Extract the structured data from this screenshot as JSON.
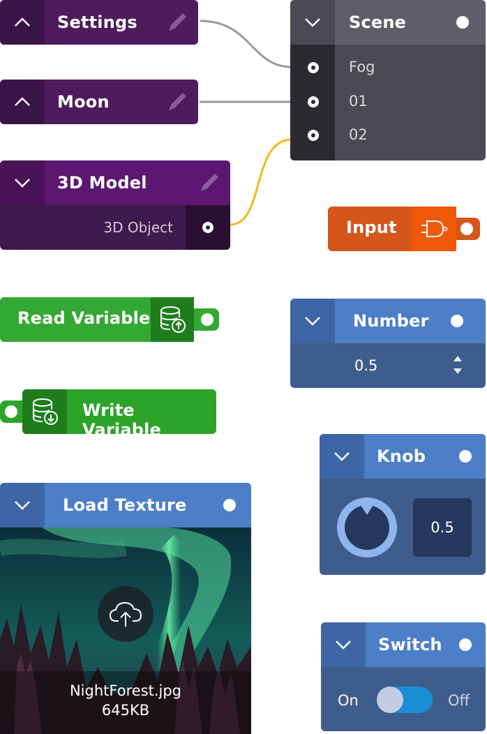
{
  "settings_node": {
    "title": "Settings",
    "collapse_icon": "chevron-up-icon",
    "edit_icon": "pencil-icon"
  },
  "moon_node": {
    "title": "Moon",
    "collapse_icon": "chevron-up-icon",
    "edit_icon": "pencil-icon"
  },
  "model_node": {
    "title": "3D Model",
    "collapse_icon": "chevron-down-icon",
    "edit_icon": "pencil-icon",
    "output_label": "3D Object"
  },
  "scene_node": {
    "title": "Scene",
    "inputs": [
      "Fog",
      "01",
      "02"
    ]
  },
  "input_node": {
    "title": "Input",
    "icon": "plug-icon"
  },
  "read_var_node": {
    "title": "Read Variable",
    "icon": "database-upload-icon"
  },
  "write_var_node": {
    "title": "Write Variable",
    "icon": "database-download-icon"
  },
  "number_node": {
    "title": "Number",
    "value": "0.5"
  },
  "knob_node": {
    "title": "Knob",
    "value": "0.5",
    "level": 0.5
  },
  "texture_node": {
    "title": "Load Texture",
    "filename": "NightForest.jpg",
    "filesize": "645KB",
    "upload_icon": "cloud-upload-icon"
  },
  "switch_node": {
    "title": "Switch",
    "on_label": "On",
    "off_label": "Off",
    "state": "on"
  },
  "colors": {
    "purple_dark": "#3f1a4c",
    "purple_light": "#5a1e6b",
    "gray_panel": "#4a4a52",
    "orange": "#d4561a",
    "green": "#2ea32a",
    "blue_header": "#4d7ec8",
    "blue_body": "#3d5a8a",
    "wire_yellow": "#f2b81a"
  }
}
